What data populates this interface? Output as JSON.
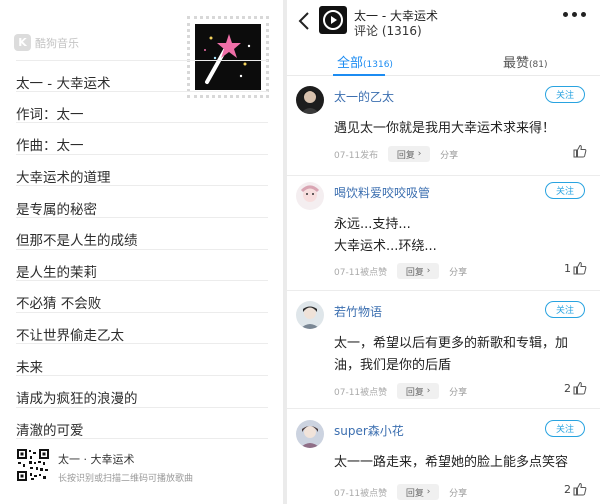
{
  "left": {
    "brand": "酷狗音乐",
    "lyrics": [
      "太一 - 大幸运术",
      "作词：太一",
      "作曲：太一",
      "大幸运术的道理",
      "是专属的秘密",
      "但那不是人生的成绩",
      "是人生的茉莉",
      "不必猜 不会败",
      "不让世界偷走乙太",
      "未来",
      "请成为疯狂的浪漫的",
      "清澈的可爱"
    ],
    "footer_title": "太一 · 大幸运术",
    "footer_sub": "长按识别或扫描二维码可播放歌曲"
  },
  "header": {
    "song_title": "太一 - 大幸运术",
    "comment_count": "评论 (1316)"
  },
  "tabs": {
    "all_label": "全部",
    "all_count": "(1316)",
    "best_label": "最赞",
    "best_count": "(81)"
  },
  "comments": [
    {
      "user": "太一的乙太",
      "follow": "关注",
      "lines": [
        "遇见太一你就是我用大幸运术求来得！"
      ],
      "time": "07-11发布",
      "reply": "回复",
      "share": "分享",
      "likes": ""
    },
    {
      "user": "喝饮料爱咬咬吸管",
      "follow": "关注",
      "lines": [
        "永远...支持...",
        "大幸运术...环绕..."
      ],
      "time": "07-11被点赞",
      "reply": "回复",
      "share": "分享",
      "likes": "1"
    },
    {
      "user": "若竹物语",
      "follow": "关注",
      "lines": [
        "太一，希望以后有更多的新歌和专辑，加",
        "油，我们是你的后盾"
      ],
      "time": "07-11被点赞",
      "reply": "回复",
      "share": "分享",
      "likes": "2"
    },
    {
      "user": "super森小花",
      "follow": "关注",
      "lines": [
        "太一一路走来，希望她的脸上能多点笑容"
      ],
      "time": "07-11被点赞",
      "reply": "回复",
      "share": "分享",
      "likes": "2"
    }
  ],
  "colors": {
    "accent": "#1c8cf2",
    "username": "#3c6fb0",
    "follow": "#29a3e0"
  }
}
